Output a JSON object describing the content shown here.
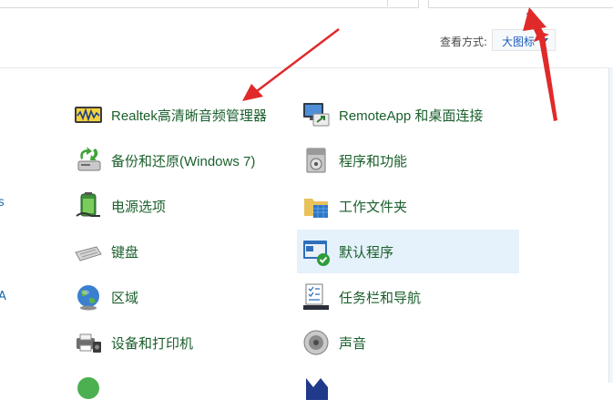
{
  "toolbar": {
    "view_by_label": "查看方式:",
    "view_by_value": "大图标"
  },
  "left_edge_glyphs": [
    "s",
    "A"
  ],
  "items_left": [
    {
      "label": "Realtek高清晰音频管理器",
      "icon": "realtek-audio-icon"
    },
    {
      "label": "备份和还原(Windows 7)",
      "icon": "backup-restore-icon"
    },
    {
      "label": "电源选项",
      "icon": "power-options-icon"
    },
    {
      "label": "键盘",
      "icon": "keyboard-icon"
    },
    {
      "label": "区域",
      "icon": "region-globe-icon"
    },
    {
      "label": "设备和打印机",
      "icon": "devices-printers-icon"
    },
    {
      "label": "",
      "icon": "partial-green-icon"
    }
  ],
  "items_right": [
    {
      "label": "RemoteApp 和桌面连接",
      "icon": "remoteapp-icon"
    },
    {
      "label": "程序和功能",
      "icon": "programs-features-icon"
    },
    {
      "label": "工作文件夹",
      "icon": "work-folders-icon"
    },
    {
      "label": "默认程序",
      "icon": "default-programs-icon",
      "selected": true
    },
    {
      "label": "任务栏和导航",
      "icon": "taskbar-navigation-icon"
    },
    {
      "label": "声音",
      "icon": "sound-speaker-icon"
    },
    {
      "label": "",
      "icon": "partial-blue-icon"
    }
  ],
  "colors": {
    "link_green": "#1a5f2c",
    "selection_bg": "#e5f1fb",
    "annotation_red": "#e02a2a",
    "view_link_blue": "#1e5bb8"
  }
}
